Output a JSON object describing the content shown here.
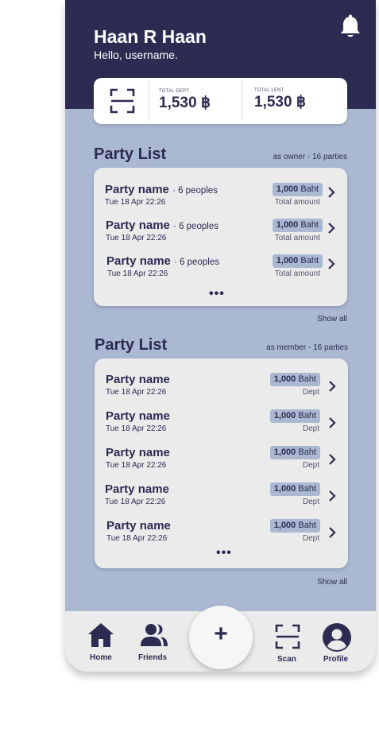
{
  "header": {
    "title": "Haan R Haan",
    "greeting": "Hello, username.",
    "notification_icon": "bell-icon"
  },
  "summary": {
    "scan_icon": "scan-icon",
    "total_dept_label": "TOTAL DEPT",
    "total_dept_value": "1,530 ฿",
    "total_lent_label": "TOTAL LENT",
    "total_lent_value": "1,530 ฿"
  },
  "owner_section": {
    "title": "Party List",
    "subtitle": "as owner - 16 parties",
    "show_all": "Show all",
    "more": "•••",
    "items": [
      {
        "name": "Party name",
        "people": "· 6 peoples",
        "date": "Tue 18 Apr 22:26",
        "amount": "1,000",
        "unit": "Baht",
        "type": "Total amount"
      },
      {
        "name": "Party name",
        "people": "· 6 peoples",
        "date": "Tue 18 Apr 22:26",
        "amount": "1,000",
        "unit": "Baht",
        "type": "Total amount"
      },
      {
        "name": "Party name",
        "people": "· 6 peoples",
        "date": "Tue 18 Apr 22:26",
        "amount": "1,000",
        "unit": "Baht",
        "type": "Total amount"
      }
    ]
  },
  "member_section": {
    "title": "Party List",
    "subtitle": "as member - 16 parties",
    "show_all": "Show all",
    "more": "•••",
    "items": [
      {
        "name": "Party name",
        "date": "Tue 18 Apr 22:26",
        "amount": "1,000",
        "unit": "Baht",
        "type": "Dept"
      },
      {
        "name": "Party name",
        "date": "Tue 18 Apr 22:26",
        "amount": "1,000",
        "unit": "Baht",
        "type": "Dept"
      },
      {
        "name": "Party name",
        "date": "Tue 18 Apr 22:26",
        "amount": "1,000",
        "unit": "Baht",
        "type": "Dept"
      },
      {
        "name": "Party name",
        "date": "Tue 18 Apr 22:26",
        "amount": "1,000",
        "unit": "Baht",
        "type": "Dept"
      },
      {
        "name": "Party name",
        "date": "Tue 18 Apr 22:26",
        "amount": "1,000",
        "unit": "Baht",
        "type": "Dept"
      }
    ]
  },
  "nav": {
    "home": "Home",
    "friends": "Friends",
    "add": "+",
    "scan": "Scan",
    "profile": "Profile"
  },
  "colors": {
    "primary": "#2c2b52",
    "background": "#aab8d2",
    "card": "#ebebeb"
  }
}
